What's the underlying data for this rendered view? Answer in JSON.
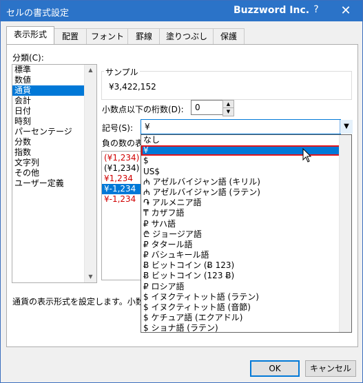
{
  "window": {
    "title": "セルの書式設定",
    "brand": "Buzzword Inc.",
    "help": "?",
    "close": "✕"
  },
  "tabs": [
    "表示形式",
    "配置",
    "フォント",
    "罫線",
    "塗りつぶし",
    "保護"
  ],
  "category": {
    "label": "分類(C):",
    "items": [
      "標準",
      "数値",
      "通貨",
      "会計",
      "日付",
      "時刻",
      "パーセンテージ",
      "分数",
      "指数",
      "文字列",
      "その他",
      "ユーザー定義"
    ],
    "selected": "通貨"
  },
  "sample": {
    "label": "サンプル",
    "value": "¥3,422,152"
  },
  "decimal": {
    "label": "小数点以下の桁数(D):",
    "value": "0"
  },
  "symbol": {
    "label": "記号(S):",
    "value": "¥"
  },
  "negative": {
    "label": "負の数の表",
    "items": [
      {
        "text": "(¥1,234)",
        "red": true
      },
      {
        "text": "(¥1,234)",
        "red": false
      },
      {
        "text": "¥1,234",
        "red": true
      },
      {
        "text": "¥-1,234",
        "red": false,
        "selected": true
      },
      {
        "text": "¥-1,234",
        "red": true
      }
    ]
  },
  "symbol_options": [
    "なし",
    "¥",
    "$",
    "US$",
    "₼ アゼルバイジャン語 (キリル)",
    "₼ アゼルバイジャン語 (ラテン)",
    "֏ アルメニア語",
    "₸ カザフ語",
    "₽ サハ語",
    "₾ ジョージア語",
    "₽ タタール語",
    "₽ バシュキール語",
    "Ƀ ビットコイン (Ƀ 123)",
    "Ƀ ビットコイン (123 Ƀ)",
    "₽ ロシア語",
    "$ イヌクティトット語 (ラテン)",
    "$ イヌクティトット語 (音節)",
    "$ ケチュア語 (エクアドル)",
    "$ ショナ語 (ラテン)"
  ],
  "symbol_selected_index": 1,
  "description": "通貨の表示形式を設定します。小数点",
  "buttons": {
    "ok": "OK",
    "cancel": "キャンセル"
  }
}
